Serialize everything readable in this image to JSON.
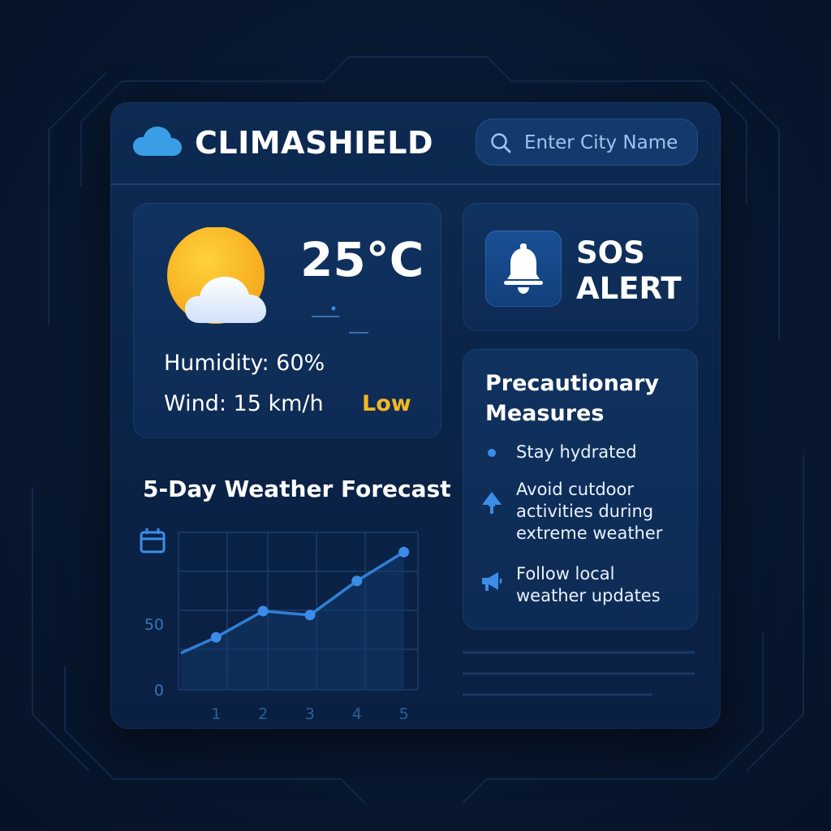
{
  "app": {
    "title": "CLIMASHIELD",
    "icons": {
      "logo": "cloud-icon",
      "search": "search-icon"
    }
  },
  "search": {
    "placeholder": "Enter City Name",
    "value": ""
  },
  "current": {
    "temperature": "25°C",
    "humidity": "Humidity: 60%",
    "wind": "Wind: 15 km/h",
    "level": "Low",
    "icon": "sun-cloud-icon"
  },
  "sos": {
    "title_line1": "SOS",
    "title_line2": "ALERT",
    "icon": "bell-icon"
  },
  "measures": {
    "title": "Precautionary Measures",
    "items": [
      {
        "text": "Stay hydrated",
        "icon": "dot-icon"
      },
      {
        "text": "Avoid cutdoor activities during extreme weather",
        "icon": "tree-icon"
      },
      {
        "text": "Follow local weather updates",
        "icon": "megaphone-icon"
      }
    ]
  },
  "colors": {
    "accent": "#3b8de8",
    "warning": "#f5b623",
    "panel": "#0b2448",
    "background": "#081831"
  },
  "chart_data": {
    "type": "line",
    "title": "5-Day Weather Forecast",
    "icon": "calendar-icon",
    "x": [
      1,
      2,
      3,
      4,
      5
    ],
    "y_ticks": [
      "0",
      "50"
    ],
    "x_ticks": [
      "1",
      "2",
      "3",
      "4",
      "5"
    ],
    "series": [
      {
        "values": [
          40,
          60,
          57,
          83,
          105
        ]
      }
    ],
    "line_start_value": 28,
    "ylim": [
      0,
      120
    ],
    "xlim": [
      0.2,
      5.3
    ],
    "grid": true
  }
}
